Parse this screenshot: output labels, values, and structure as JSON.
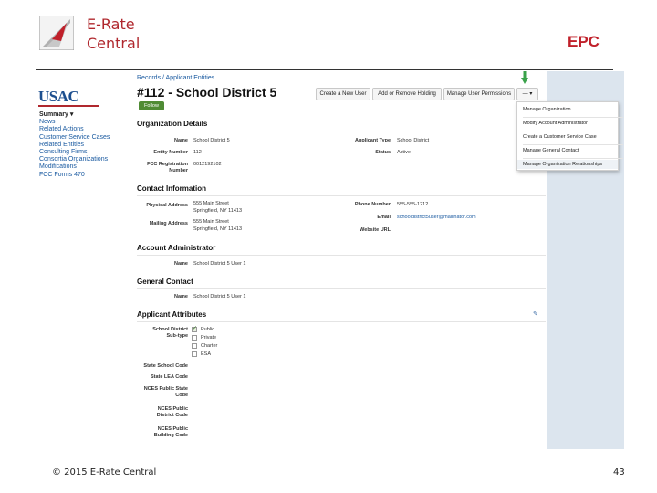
{
  "slide": {
    "brand_line1": "E-Rate",
    "brand_line2": "Central",
    "tag": "EPC",
    "footer": "© 2015 E-Rate Central",
    "page_number": "43"
  },
  "colors": {
    "brand_red": "#b0282e",
    "link_blue": "#1a5aa0",
    "follow_green": "#4f8b34",
    "arrow_green": "#3aa24a"
  },
  "nav": {
    "logo_text": "USAC",
    "items": [
      "Summary ▾",
      "News",
      "Related Actions",
      "Customer Service Cases",
      "Related Entities",
      "Consulting Firms",
      "Consortia Organizations",
      "Modifications",
      "FCC Forms 470"
    ]
  },
  "header": {
    "breadcrumb": "Records / Applicant Entities",
    "title": "#112 - School District 5",
    "follow": "Follow",
    "buttons": [
      "Create a New User",
      "Add or Remove Holding",
      "Manage User Permissions",
      "— ▾"
    ]
  },
  "dropdown": {
    "items": [
      "Manage Organization",
      "Modify Account Administrator",
      "Create a Customer Service Case",
      "Manage General Contact",
      "Manage Organization Relationships"
    ]
  },
  "org": {
    "heading": "Organization Details",
    "name_label": "Name",
    "name_value": "School District 5",
    "entity_label": "Entity Number",
    "entity_value": "112",
    "fcc_label": "FCC Registration Number",
    "fcc_value": "0012192102",
    "type_label": "Applicant Type",
    "type_value": "School District",
    "status_label": "Status",
    "status_value": "Active"
  },
  "contact": {
    "heading": "Contact Information",
    "physical_label": "Physical Address",
    "physical_l1": "555 Main Street",
    "physical_l2": "Springfield, NY 11413",
    "mailing_label": "Mailing Address",
    "mailing_l1": "555 Main Street",
    "mailing_l2": "Springfield, NY 11413",
    "phone_label": "Phone Number",
    "phone_value": "555-555-1212",
    "email_label": "Email",
    "email_value": "schooldistrict5user@mailinator.com",
    "website_label": "Website URL"
  },
  "admin": {
    "heading": "Account Administrator",
    "name_label": "Name",
    "name_value": "School District 5 User 1"
  },
  "general": {
    "heading": "General Contact",
    "name_label": "Name",
    "name_value": "School District 5 User 1"
  },
  "attributes": {
    "heading": "Applicant Attributes",
    "subtype_label_1": "School District",
    "subtype_label_2": "Sub-type",
    "options": [
      "Public",
      "Private",
      "Charter",
      "ESA"
    ],
    "state_code": "State School Code",
    "lea_code": "State LEA Code",
    "nces_state_1": "NCES Public State",
    "nces_state_2": "Code",
    "nces_district_1": "NCES Public",
    "nces_district_2": "District Code",
    "nces_building_1": "NCES Public",
    "nces_building_2": "Building Code"
  }
}
